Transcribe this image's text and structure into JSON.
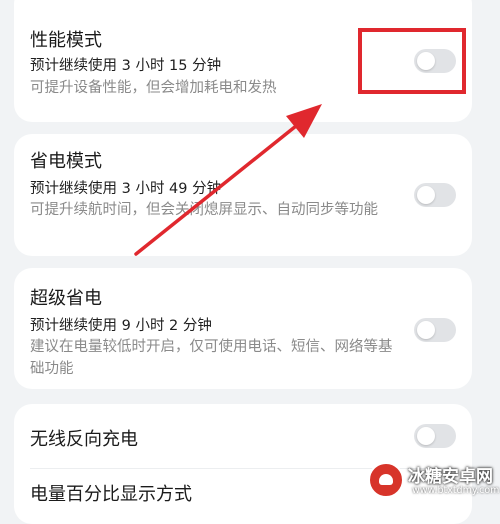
{
  "settings": {
    "performance": {
      "title": "性能模式",
      "estimate": "预计继续使用 3 小时 15 分钟",
      "description": "可提升设备性能，但会增加耗电和发热",
      "enabled": false
    },
    "power_saving": {
      "title": "省电模式",
      "estimate": "预计继续使用 3 小时 49 分钟",
      "description": "可提升续航时间，但会关闭熄屏显示、自动同步等功能",
      "enabled": false
    },
    "super_power_saving": {
      "title": "超级省电",
      "estimate": "预计继续使用 9 小时 2 分钟",
      "description": "建议在电量较低时开启，仅可使用电话、短信、网络等基础功能",
      "enabled": false
    },
    "wireless_reverse_charging": {
      "title": "无线反向充电",
      "enabled": false
    },
    "battery_percentage_display": {
      "title": "电量百分比显示方式"
    }
  },
  "annotation": {
    "highlight_color": "#e0282e"
  },
  "watermark": {
    "name": "冰糖安卓网",
    "url": "www.btxtdmy.com"
  },
  "colors": {
    "background": "#f1f3f5",
    "card": "#ffffff",
    "toggle_off": "#e1e3e6"
  }
}
